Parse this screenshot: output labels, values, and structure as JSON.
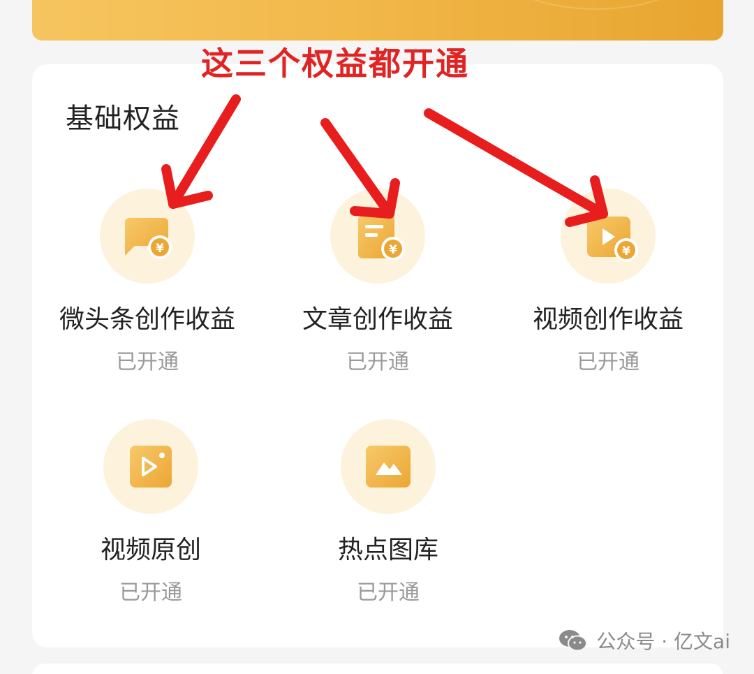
{
  "annotation": {
    "title": "这三个权益都开通",
    "color": "#e02424"
  },
  "section": {
    "title": "基础权益"
  },
  "benefits": [
    {
      "label": "微头条创作收益",
      "status": "已开通",
      "icon": "chat-bubble-yen-icon"
    },
    {
      "label": "文章创作收益",
      "status": "已开通",
      "icon": "document-yen-icon"
    },
    {
      "label": "视频创作收益",
      "status": "已开通",
      "icon": "video-play-yen-icon"
    },
    {
      "label": "视频原创",
      "status": "已开通",
      "icon": "video-original-icon"
    },
    {
      "label": "热点图库",
      "status": "已开通",
      "icon": "image-gallery-icon"
    }
  ],
  "watermark": {
    "text": "公众号 · 亿文ai",
    "icon": "wechat-icon"
  },
  "colors": {
    "accent_gold": "#f2b84a",
    "icon_bg": "#fdf3dc",
    "status_gray": "#9a9a9a"
  }
}
